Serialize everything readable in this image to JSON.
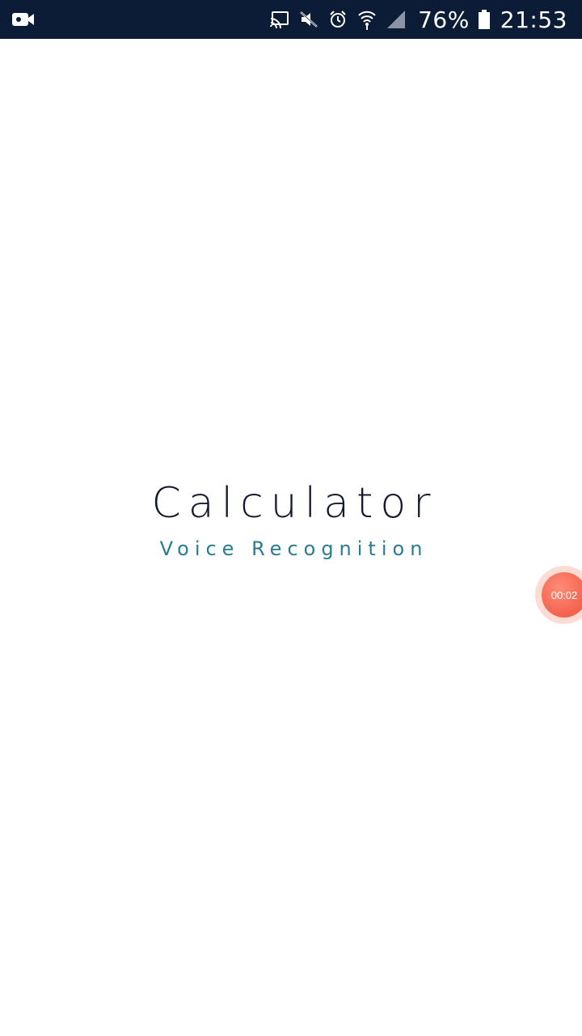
{
  "status_bar": {
    "left_icon": "video-camera-icon",
    "icons": [
      "cast-icon",
      "mute-icon",
      "alarm-icon",
      "wifi-icon",
      "signal-icon"
    ],
    "battery_percent": "76%",
    "battery_icon": "battery-icon",
    "time": "21:53"
  },
  "splash": {
    "title": "Calculator",
    "subtitle": "Voice Recognition"
  },
  "recorder": {
    "elapsed": "00:02"
  },
  "colors": {
    "status_bar_bg": "#0c1c36",
    "title": "#14192e",
    "subtitle": "#2b7c93",
    "recorder": "#f4624d"
  }
}
